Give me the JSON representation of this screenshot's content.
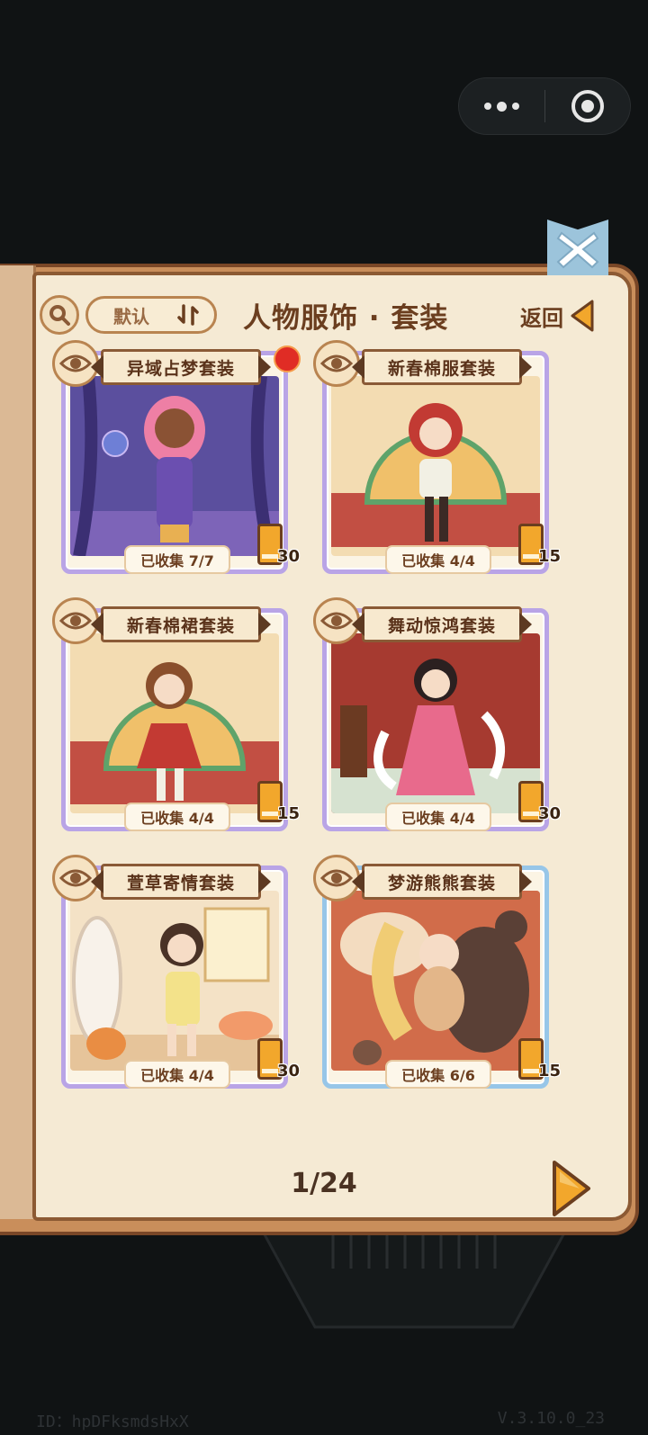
{
  "header": {
    "title": "人物服饰 · 套装",
    "sort_label": "默认",
    "back_label": "返回"
  },
  "cards": [
    {
      "name": "异域占梦套装",
      "progress": "已收集 7/7",
      "points": "30",
      "frame": "purple",
      "has_badge": true
    },
    {
      "name": "新春棉服套装",
      "progress": "已收集 4/4",
      "points": "15",
      "frame": "purple",
      "has_badge": false
    },
    {
      "name": "新春棉裙套装",
      "progress": "已收集 4/4",
      "points": "15",
      "frame": "purple",
      "has_badge": false
    },
    {
      "name": "舞动惊鸿套装",
      "progress": "已收集 4/4",
      "points": "30",
      "frame": "purple",
      "has_badge": false
    },
    {
      "name": "萱草寄情套装",
      "progress": "已收集 4/4",
      "points": "30",
      "frame": "purple",
      "has_badge": false
    },
    {
      "name": "梦游熊熊套装",
      "progress": "已收集 6/6",
      "points": "15",
      "frame": "blue",
      "has_badge": false
    }
  ],
  "pager": {
    "text": "1/24"
  },
  "footer": {
    "id": "ID：hpDFksmdsHxX",
    "version": "V.3.10.0_23"
  },
  "colors": {
    "background": "#101314",
    "page": "#f5ead4",
    "accent": "#f2a72c",
    "frame_purple": "#b9a4e6",
    "frame_blue": "#97c6e8"
  }
}
